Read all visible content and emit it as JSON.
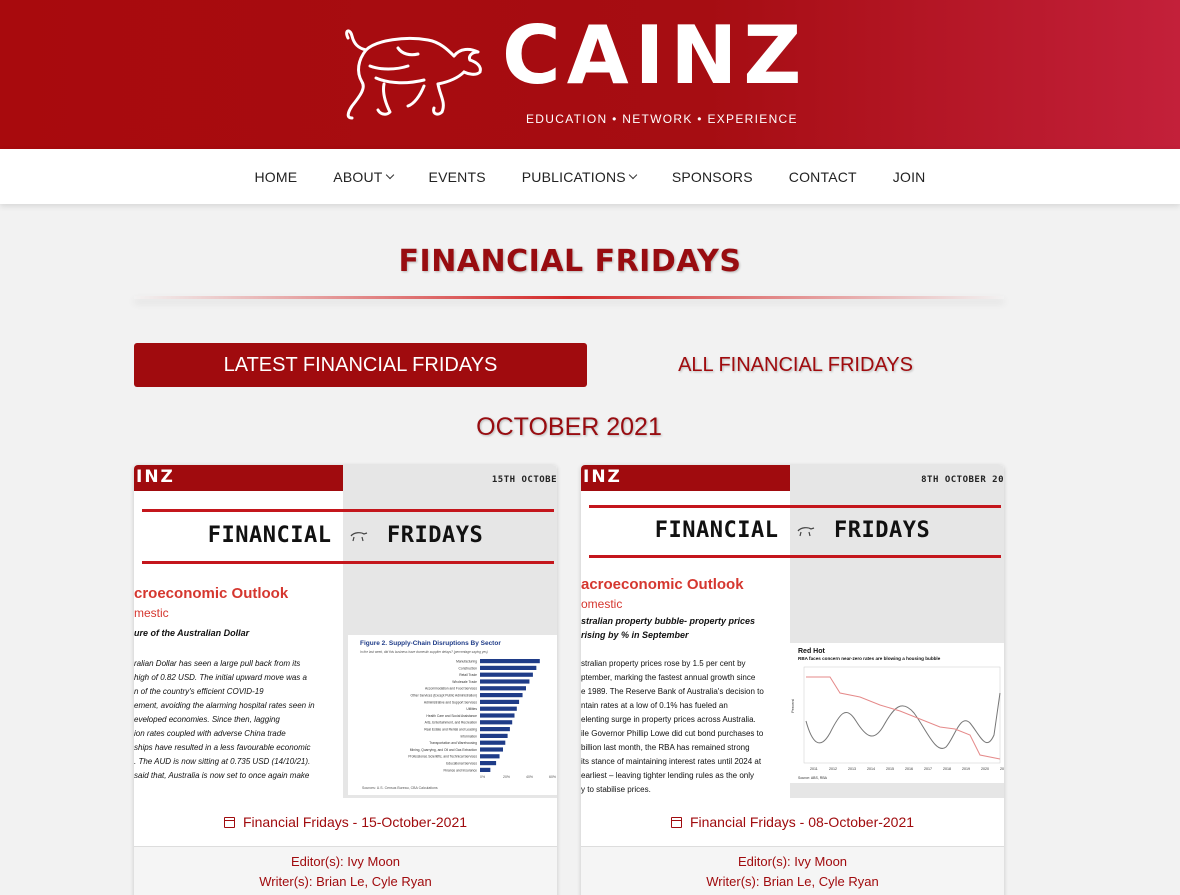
{
  "brand": {
    "name": "CAINZ",
    "tagline": "EDUCATION • NETWORK • EXPERIENCE"
  },
  "nav": {
    "items": [
      {
        "label": "HOME",
        "dropdown": false
      },
      {
        "label": "ABOUT",
        "dropdown": true
      },
      {
        "label": "EVENTS",
        "dropdown": false
      },
      {
        "label": "PUBLICATIONS",
        "dropdown": true
      },
      {
        "label": "SPONSORS",
        "dropdown": false
      },
      {
        "label": "CONTACT",
        "dropdown": false
      },
      {
        "label": "JOIN",
        "dropdown": false
      }
    ]
  },
  "page": {
    "title": "FINANCIAL FRIDAYS",
    "tab_latest": "LATEST FINANCIAL FRIDAYS",
    "tab_all": "ALL FINANCIAL FRIDAYS",
    "month": "OCTOBER 2021"
  },
  "colors": {
    "brand_red": "#a00b0e",
    "header_gradient_end": "#c3203a",
    "accent_red": "#d5372f"
  },
  "cards": [
    {
      "thumb": {
        "logo_fragment": "INZ",
        "date": "15TH OCTOBE",
        "masthead_left": "FINANCIAL",
        "masthead_right": "FRIDAYS",
        "section": "croeconomic Outlook",
        "subsection": "mestic",
        "heading": "ure of the Australian Dollar",
        "para_lines": [
          "ralian Dollar has seen a large pull back from its",
          "high of 0.82 USD. The initial upward move was a",
          "n of the country's efficient COVID-19",
          "ement, avoiding the alarming hospital rates seen in",
          "eveloped economies. Since then, lagging",
          "ion rates coupled with adverse China trade",
          "ships have resulted in a less favourable economic",
          ". The AUD is now sitting at 0.735 USD (14/10/21).",
          "said that, Australia is now set to once again make"
        ],
        "figure_title": "Figure 2. Supply-Chain Disruptions By Sector",
        "figure_subtitle": "In the last week, did this business have domestic supplier delays? (percentage saying yes)",
        "figure_source": "Sources: U.S. Census Bureau, CBA Calculations",
        "figure_categories": [
          "Manufacturing",
          "Construction",
          "Retail Trade",
          "Wholesale Trade",
          "Accommodation and Food Services",
          "Other Services (Except Public Administration)",
          "Administrative and Support Services",
          "Utilities",
          "Health Care and Social Assistance",
          "Arts, Entertainment, and Recreation",
          "Real Estate and Rental and Leasing",
          "Information",
          "Transportation and Warehousing",
          "Mining, Quarrying, and Oil and Gas Extraction",
          "Professional, Scientific, and Technical Services",
          "Educational Services",
          "Finance and Insurance"
        ],
        "figure_values": [
          52,
          49,
          46,
          43,
          40,
          37,
          34,
          32,
          30,
          28,
          26,
          24,
          22,
          20,
          17,
          14,
          9
        ],
        "figure_axis": [
          "0%",
          "20%",
          "40%",
          "60%"
        ]
      },
      "title": "Financial Fridays - 15-October-2021",
      "editors_label": "Editor(s):",
      "editors": "Ivy Moon",
      "writers_label": "Writer(s):",
      "writers": "Brian Le, Cyle Ryan"
    },
    {
      "thumb": {
        "logo_fragment": "INZ",
        "date": "8TH OCTOBER 20",
        "masthead_left": "FINANCIAL",
        "masthead_right": "FRIDAYS",
        "section": "acroeconomic Outlook",
        "subsection": "omestic",
        "heading": "stralian property bubble- property prices rising by % in September",
        "para_lines": [
          "stralian property prices rose by 1.5 per cent by",
          "ptember, marking the fastest annual growth since",
          "e 1989. The Reserve Bank of Australia's decision to",
          "ntain rates at a low of 0.1% has fueled an",
          "elenting surge in property prices across Australia.",
          "ile Governor Phillip Lowe did cut bond purchases to",
          "billion last month, the RBA has remained strong",
          "its stance of maintaining interest rates until 2024 at",
          "earliest – leaving tighter lending rules as the only",
          "y to stabilise prices."
        ],
        "figure_title": "Red Hot",
        "figure_subtitle": "RBA faces concern near-zero rates are blowing a housing bubble",
        "figure_source": "Source: ABS, RBA",
        "figure_ylabel": "Percent",
        "figure_years": [
          "2011",
          "2012",
          "2013",
          "2014",
          "2015",
          "2016",
          "2017",
          "2018",
          "2019",
          "2020",
          "2021"
        ]
      },
      "title": "Financial Fridays - 08-October-2021",
      "editors_label": "Editor(s):",
      "editors": "Ivy Moon",
      "writers_label": "Writer(s):",
      "writers": "Brian Le, Cyle Ryan"
    }
  ]
}
